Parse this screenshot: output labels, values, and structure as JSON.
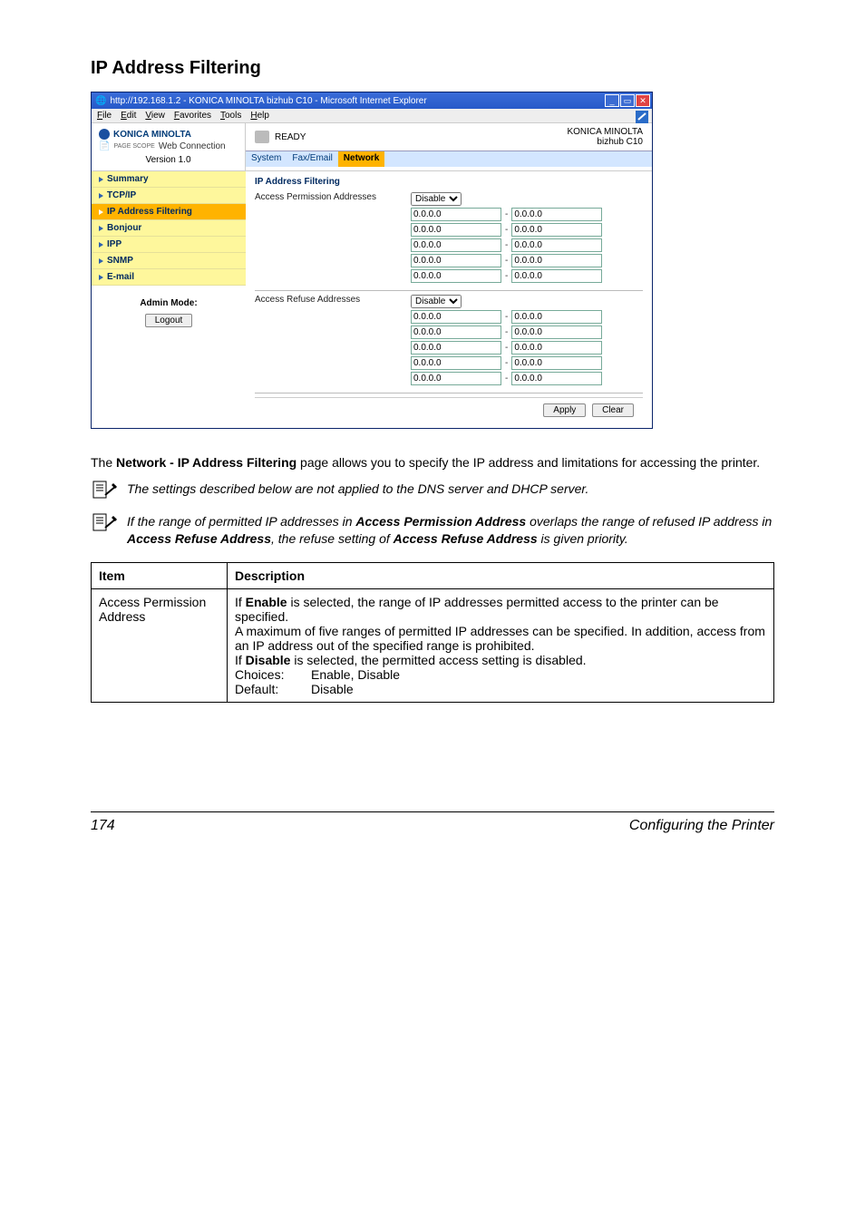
{
  "heading": "IP Address Filtering",
  "browser": {
    "title": "http://192.168.1.2 - KONICA MINOLTA bizhub C10 - Microsoft Internet Explorer",
    "menu": [
      "File",
      "Edit",
      "View",
      "Favorites",
      "Tools",
      "Help"
    ],
    "brand": "KONICA MINOLTA",
    "webconn": "Web Connection",
    "page_scope_label": "PAGE SCOPE",
    "version": "Version 1.0",
    "ready": "READY",
    "model1": "KONICA MINOLTA",
    "model2": "bizhub C10",
    "tabs": [
      "System",
      "Fax/Email",
      "Network"
    ],
    "active_tab": 2,
    "sidebar": [
      {
        "label": "Summary",
        "sel": false
      },
      {
        "label": "TCP/IP",
        "sel": false
      },
      {
        "label": "IP Address Filtering",
        "sel": true
      },
      {
        "label": "Bonjour",
        "sel": false
      },
      {
        "label": "IPP",
        "sel": false
      },
      {
        "label": "SNMP",
        "sel": false
      },
      {
        "label": "E-mail",
        "sel": false
      }
    ],
    "admin_mode": "Admin Mode:",
    "logout": "Logout",
    "panel_heading": "IP Address Filtering",
    "access_perm_label": "Access Permission Addresses",
    "access_refuse_label": "Access Refuse Addresses",
    "disable_option": "Disable",
    "ip_default": "0.0.0.0",
    "dash": "-",
    "apply": "Apply",
    "clear": "Clear"
  },
  "para1_pre": "The ",
  "para1_bold": "Network - IP Address Filtering",
  "para1_post": " page allows you to specify the IP address and limitations for accessing the printer.",
  "note1": "The settings described below are not applied to the DNS server and DHCP server.",
  "note2_pre": "If the range of permitted IP addresses in ",
  "note2_b1": "Access Permission Address",
  "note2_mid1": " overlaps the range of refused IP address in ",
  "note2_b2": "Access Refuse Address",
  "note2_mid2": ", the refuse setting of ",
  "note2_b3": "Access Refuse Address",
  "note2_post": " is given priority.",
  "table": {
    "h_item": "Item",
    "h_desc": "Description",
    "row1_item": "Access Permission Address",
    "row1": {
      "l1_pre": "If ",
      "l1_b": "Enable",
      "l1_post": " is selected, the range of IP addresses permitted access to the printer can be specified.",
      "l2": "A maximum of five ranges of permitted IP addresses can be specified. In addition, access from an IP address out of the specified range is prohibited.",
      "l3_pre": "If ",
      "l3_b": "Disable",
      "l3_post": " is selected, the permitted access setting is disabled.",
      "choices_label": "Choices:",
      "choices_val": "Enable, Disable",
      "default_label": "Default:",
      "default_val": "Disable"
    }
  },
  "footer": {
    "page": "174",
    "title": "Configuring the Printer"
  }
}
